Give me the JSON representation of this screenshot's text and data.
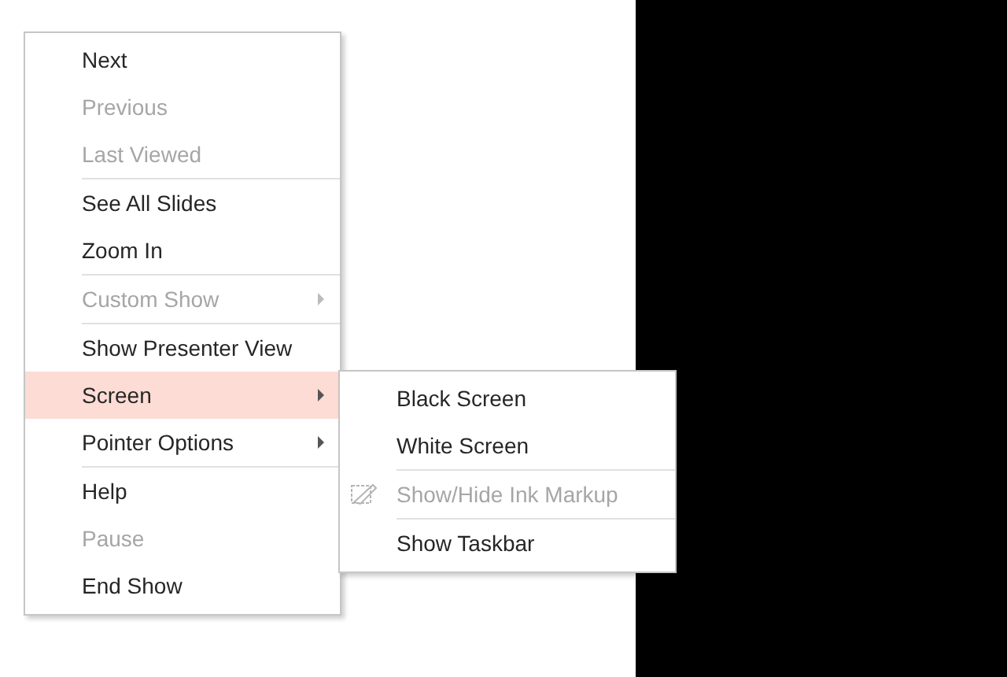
{
  "context_menu": {
    "items": [
      {
        "kind": "item",
        "label": "Next",
        "disabled": false,
        "selected": false,
        "submenu": false
      },
      {
        "kind": "item",
        "label": "Previous",
        "disabled": true,
        "selected": false,
        "submenu": false
      },
      {
        "kind": "item",
        "label": "Last Viewed",
        "disabled": true,
        "selected": false,
        "submenu": false
      },
      {
        "kind": "separator"
      },
      {
        "kind": "item",
        "label": "See All Slides",
        "disabled": false,
        "selected": false,
        "submenu": false
      },
      {
        "kind": "item",
        "label": "Zoom In",
        "disabled": false,
        "selected": false,
        "submenu": false
      },
      {
        "kind": "separator"
      },
      {
        "kind": "item",
        "label": "Custom Show",
        "disabled": true,
        "selected": false,
        "submenu": true
      },
      {
        "kind": "separator"
      },
      {
        "kind": "item",
        "label": "Show Presenter View",
        "disabled": false,
        "selected": false,
        "submenu": false
      },
      {
        "kind": "item",
        "label": "Screen",
        "disabled": false,
        "selected": true,
        "submenu": true
      },
      {
        "kind": "item",
        "label": "Pointer Options",
        "disabled": false,
        "selected": false,
        "submenu": true
      },
      {
        "kind": "separator"
      },
      {
        "kind": "item",
        "label": "Help",
        "disabled": false,
        "selected": false,
        "submenu": false
      },
      {
        "kind": "item",
        "label": "Pause",
        "disabled": true,
        "selected": false,
        "submenu": false
      },
      {
        "kind": "item",
        "label": "End Show",
        "disabled": false,
        "selected": false,
        "submenu": false
      }
    ]
  },
  "submenu": {
    "items": [
      {
        "kind": "item",
        "label": "Black Screen",
        "disabled": false,
        "selected": false,
        "submenu": false
      },
      {
        "kind": "item",
        "label": "White Screen",
        "disabled": false,
        "selected": false,
        "submenu": false
      },
      {
        "kind": "separator"
      },
      {
        "kind": "icon-item",
        "label": "Show/Hide Ink Markup",
        "disabled": true,
        "selected": false,
        "submenu": false
      },
      {
        "kind": "separator"
      },
      {
        "kind": "item",
        "label": "Show Taskbar",
        "disabled": false,
        "selected": false,
        "submenu": false
      }
    ]
  }
}
